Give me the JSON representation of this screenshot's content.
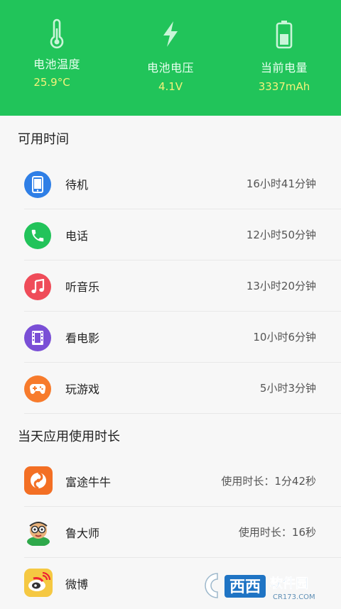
{
  "header": {
    "stats": [
      {
        "icon": "thermometer-icon",
        "label": "电池温度",
        "value": "25.9°C"
      },
      {
        "icon": "lightning-icon",
        "label": "电池电压",
        "value": "4.1V"
      },
      {
        "icon": "battery-icon",
        "label": "当前电量",
        "value": "3337mAh"
      }
    ]
  },
  "usage": {
    "title": "可用时间",
    "items": [
      {
        "icon": "phone-device-icon",
        "label": "待机",
        "value": "16小时41分钟",
        "color": "#2f7fe6"
      },
      {
        "icon": "call-icon",
        "label": "电话",
        "value": "12小时50分钟",
        "color": "#22c35a"
      },
      {
        "icon": "music-note-icon",
        "label": "听音乐",
        "value": "13小时20分钟",
        "color": "#ef4c59"
      },
      {
        "icon": "film-icon",
        "label": "看电影",
        "value": "10小时6分钟",
        "color": "#7a4fd6"
      },
      {
        "icon": "gamepad-icon",
        "label": "玩游戏",
        "value": "5小时3分钟",
        "color": "#f77b2c"
      }
    ]
  },
  "apps": {
    "title": "当天应用使用时长",
    "items": [
      {
        "icon": "futu-app-icon",
        "label": "富途牛牛",
        "value": "使用时长：1分42秒"
      },
      {
        "icon": "ludashi-app-icon",
        "label": "鲁大师",
        "value": "使用时长：16秒"
      },
      {
        "icon": "weibo-app-icon",
        "label": "微博",
        "value": ""
      }
    ]
  },
  "watermark": {
    "text_main": "西西",
    "text_side": "软件园",
    "text_sub": "CR173.COM"
  },
  "colors": {
    "header": "#21c45a",
    "stat_value": "#f5f27a"
  }
}
